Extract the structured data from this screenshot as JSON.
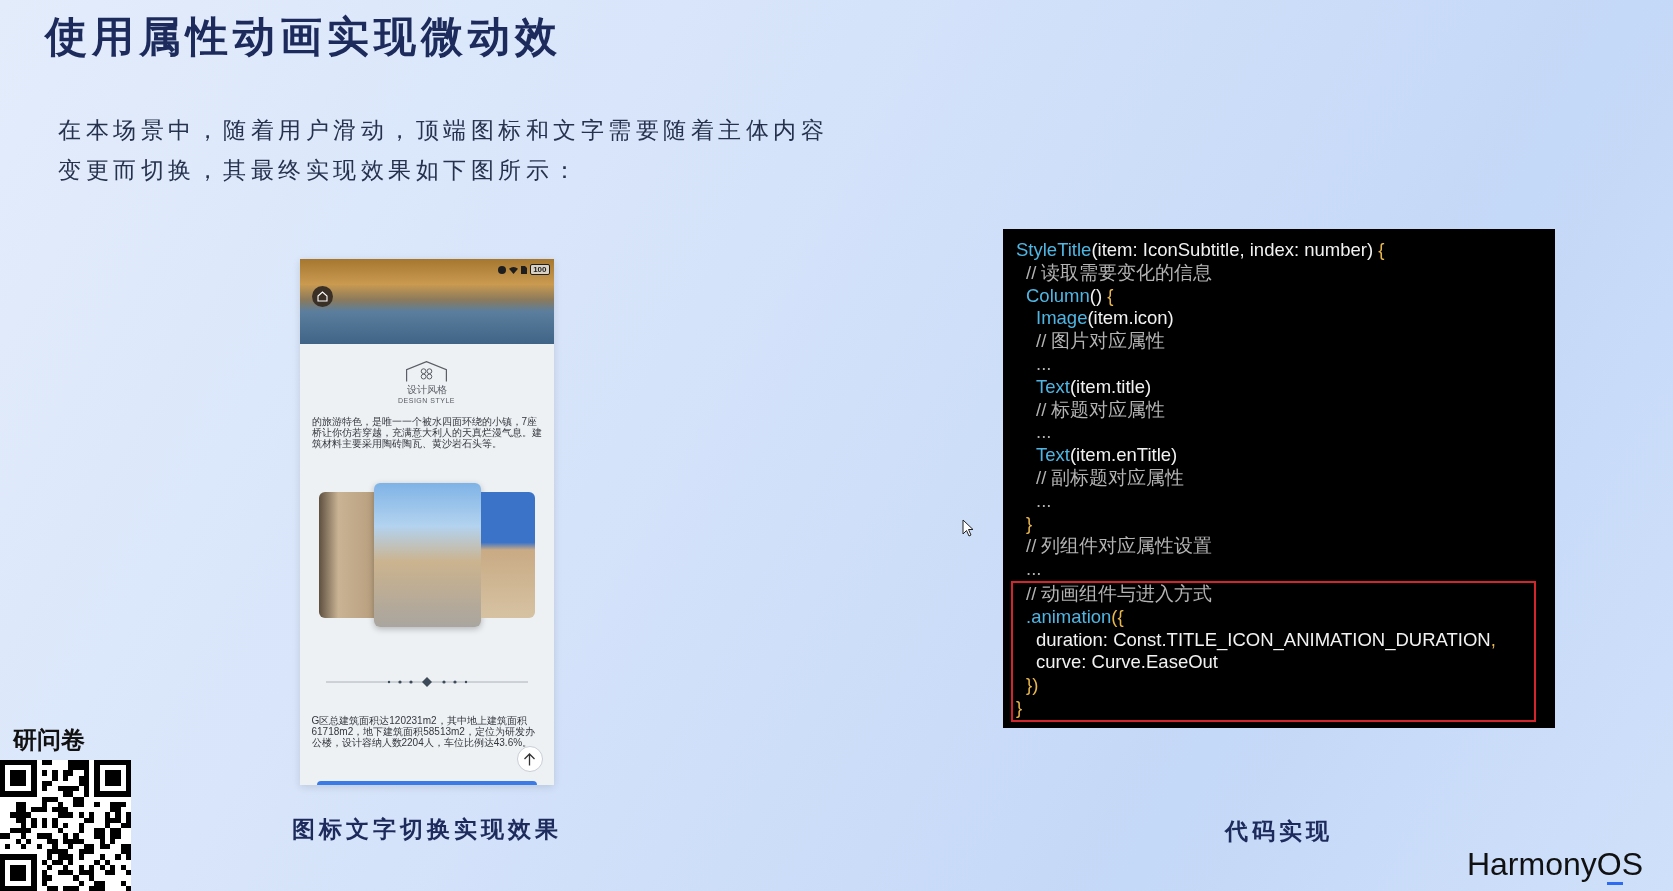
{
  "title": "使用属性动画实现微动效",
  "intro": "在本场景中，随着用户滑动，顶端图标和文字需要随着主体内容变更而切换，其最终实现效果如下图所示：",
  "demo": {
    "phone": {
      "battery": "100",
      "section_title": "设计风格",
      "section_subtitle": "DESIGN STYLE",
      "intro_text": "的旅游特色，是唯一一个被水四面环绕的小镇，7座桥让你仿若穿越，充满意大利人的天真烂漫气息。建筑材料主要采用陶砖陶瓦、黄沙岩石头等。",
      "body_text": "G区总建筑面积达120231m2，其中地上建筑面积61718m2，地下建筑面积58513m2，定位为研发办公楼，设计容纳人数2204人，车位比例达43.6%。"
    },
    "caption": "图标文字切换实现效果"
  },
  "code_panel": {
    "lines": [
      {
        "tokens": [
          {
            "kind": "fn",
            "text": "StyleTitle"
          },
          {
            "kind": "plain",
            "text": "(item: IconSubtitle, index: number)"
          },
          {
            "kind": "punct",
            "text": " {"
          }
        ],
        "highlighted": false,
        "children": [
          {
            "tokens": [
              {
                "kind": "comment",
                "text": "// 读取需要变化的信息"
              }
            ],
            "highlighted": false
          },
          {
            "tokens": [
              {
                "kind": "fn",
                "text": "Column"
              },
              {
                "kind": "plain",
                "text": "()"
              },
              {
                "kind": "punct",
                "text": " {"
              }
            ],
            "highlighted": false,
            "children": [
              {
                "tokens": [
                  {
                    "kind": "fn",
                    "text": "Image"
                  },
                  {
                    "kind": "plain",
                    "text": "(item.icon)"
                  }
                ],
                "highlighted": false
              },
              {
                "tokens": [
                  {
                    "kind": "comment",
                    "text": "// 图片对应属性"
                  }
                ],
                "highlighted": false
              },
              {
                "tokens": [
                  {
                    "kind": "comment",
                    "text": "..."
                  }
                ],
                "highlighted": false
              },
              {
                "tokens": [
                  {
                    "kind": "fn",
                    "text": "Text"
                  },
                  {
                    "kind": "plain",
                    "text": "(item.title)"
                  }
                ],
                "highlighted": false
              },
              {
                "tokens": [
                  {
                    "kind": "comment",
                    "text": "// 标题对应属性"
                  }
                ],
                "highlighted": false
              },
              {
                "tokens": [
                  {
                    "kind": "comment",
                    "text": "..."
                  }
                ],
                "highlighted": false
              },
              {
                "tokens": [
                  {
                    "kind": "fn",
                    "text": "Text"
                  },
                  {
                    "kind": "plain",
                    "text": "(item.enTitle)"
                  }
                ],
                "highlighted": false
              },
              {
                "tokens": [
                  {
                    "kind": "comment",
                    "text": "// 副标题对应属性"
                  }
                ],
                "highlighted": false
              },
              {
                "tokens": [
                  {
                    "kind": "comment",
                    "text": "..."
                  }
                ],
                "highlighted": false
              }
            ]
          },
          {
            "tokens": [
              {
                "kind": "punct",
                "text": "}"
              }
            ],
            "highlighted": false
          },
          {
            "tokens": [
              {
                "kind": "comment",
                "text": "// 列组件对应属性设置"
              }
            ],
            "highlighted": false
          },
          {
            "tokens": [
              {
                "kind": "comment",
                "text": "..."
              }
            ],
            "highlighted": false
          },
          {
            "tokens": [
              {
                "kind": "comment",
                "text": "// 动画组件与进入方式"
              }
            ],
            "highlighted": true
          },
          {
            "tokens": [
              {
                "kind": "fn",
                "text": ".animation"
              },
              {
                "kind": "punct",
                "text": "({"
              }
            ],
            "highlighted": true,
            "children": [
              {
                "tokens": [
                  {
                    "kind": "plain",
                    "text": "duration: Const.TITLE_ICON_ANIMATION_DURATION"
                  },
                  {
                    "kind": "punct",
                    "text": ","
                  }
                ],
                "highlighted": true
              },
              {
                "tokens": [
                  {
                    "kind": "plain",
                    "text": "curve: Curve.EaseOut"
                  }
                ],
                "highlighted": true
              }
            ]
          },
          {
            "tokens": [
              {
                "kind": "punct",
                "text": "})"
              }
            ],
            "highlighted": true
          }
        ]
      },
      {
        "tokens": [
          {
            "kind": "punct",
            "text": "}"
          }
        ],
        "highlighted": true
      }
    ],
    "caption": "代码实现"
  },
  "survey": {
    "title": "研问卷"
  },
  "logo": {
    "text": "HarmonyOS"
  }
}
